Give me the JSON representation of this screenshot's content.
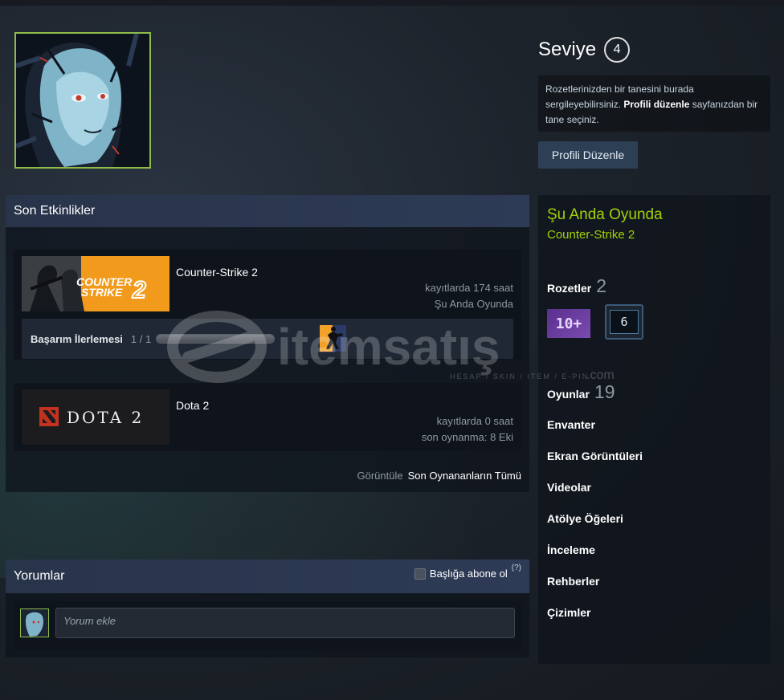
{
  "level": {
    "label": "Seviye",
    "value": "4"
  },
  "badge_note": {
    "text_1": "Rozetlerinizden bir tanesini burada sergileyebilirsiniz. ",
    "link": "Profili düzenle",
    "text_2": " sayfanızdan bir tane seçiniz."
  },
  "edit_profile_label": "Profili Düzenle",
  "activity": {
    "title": "Son Etkinlikler",
    "games": [
      {
        "name": "Counter-Strike 2",
        "capsule_text": "COUNTER STRIKE 2",
        "hours": "kayıtlarda 174 saat",
        "status": "Şu Anda Oyunda",
        "achievement_label": "Başarım İlerlemesi",
        "achievement_count": "1 / 1",
        "achievement_progress": 1.0
      },
      {
        "name": "Dota 2",
        "capsule_text": "DOTA 2",
        "hours": "kayıtlarda 0 saat",
        "status": "son oynanma: 8 Eki"
      }
    ],
    "view_prefix": "Görüntüle",
    "view_link": "Son Oynananların Tümü"
  },
  "comments": {
    "title": "Yorumlar",
    "subscribe_label": "Başlığa abone ol",
    "help": "(?)",
    "placeholder": "Yorum ekle"
  },
  "sidebar": {
    "now_playing": "Şu Anda Oyunda",
    "now_game": "Counter-Strike 2",
    "badges_label": "Rozetler",
    "badges_count": "2",
    "badge_1_text": "10+",
    "badge_2_text": "6",
    "games_label": "Oyunlar",
    "games_count": "19",
    "links": [
      "Envanter",
      "Ekran Görüntüleri",
      "Videolar",
      "Atölye Öğeleri",
      "İnceleme",
      "Rehberler",
      "Çizimler"
    ]
  },
  "watermark": {
    "brand": "itemsatış",
    "tagline": "HESAP / SKIN / ITEM / E-PIN",
    "suffix": ".com"
  },
  "colors": {
    "accent_green": "#a4d007",
    "avatar_border": "#8fbc49",
    "header_blue": "#2e3b56"
  }
}
